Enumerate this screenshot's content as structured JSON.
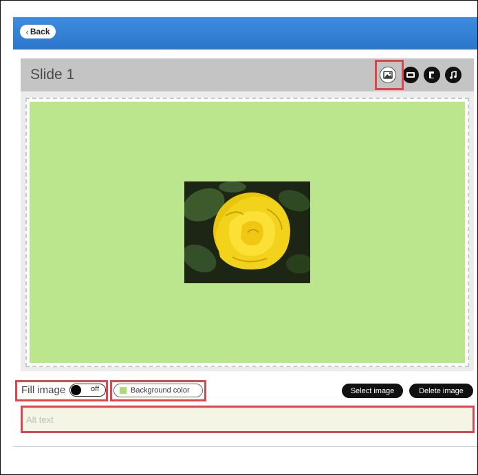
{
  "header": {
    "back_label": "Back"
  },
  "slide": {
    "title": "Slide 1",
    "toolbar_icons": [
      "image-icon",
      "media-icon",
      "layout-icon",
      "music-note-icon"
    ],
    "background_color": "#bce68e",
    "image": {
      "subject": "yellow-rose"
    }
  },
  "controls": {
    "fill_image_label": "Fill image",
    "fill_image_toggle": "off",
    "background_color_label": "Background color",
    "background_swatch": "#a8de78",
    "select_image_label": "Select image",
    "delete_image_label": "Delete image"
  },
  "alt_text": {
    "placeholder": "Alt text",
    "value": ""
  },
  "colors": {
    "header": "#2c76cc",
    "highlight": "#e0454d"
  }
}
